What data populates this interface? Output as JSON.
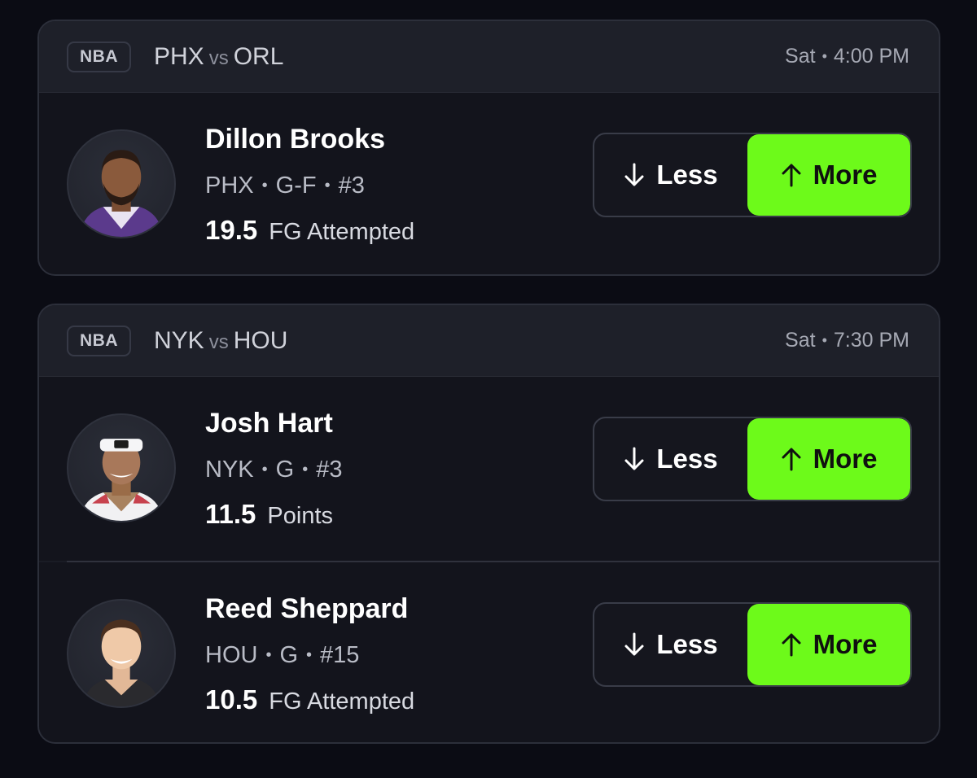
{
  "games": [
    {
      "league": "NBA",
      "home": "PHX",
      "vs": "vs",
      "away": "ORL",
      "day": "Sat",
      "time": "4:00 PM",
      "players": [
        {
          "name": "Dillon Brooks",
          "team": "PHX",
          "position": "G-F",
          "number": "#3",
          "line": "19.5",
          "stat": "FG Attempted",
          "less_label": "Less",
          "more_label": "More"
        }
      ]
    },
    {
      "league": "NBA",
      "home": "NYK",
      "vs": "vs",
      "away": "HOU",
      "day": "Sat",
      "time": "7:30 PM",
      "players": [
        {
          "name": "Josh Hart",
          "team": "NYK",
          "position": "G",
          "number": "#3",
          "line": "11.5",
          "stat": "Points",
          "less_label": "Less",
          "more_label": "More"
        },
        {
          "name": "Reed Sheppard",
          "team": "HOU",
          "position": "G",
          "number": "#15",
          "line": "10.5",
          "stat": "FG Attempted",
          "less_label": "Less",
          "more_label": "More"
        }
      ]
    }
  ],
  "colors": {
    "more_accent": "#6dfa1a",
    "card_bg": "#1a1c25",
    "page_bg": "#0b0c14"
  }
}
